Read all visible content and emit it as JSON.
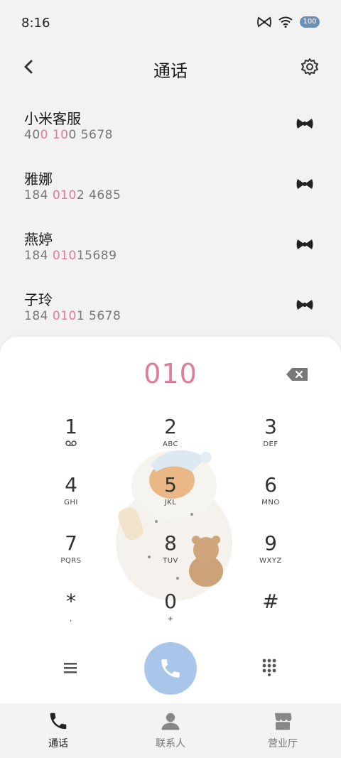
{
  "status_bar": {
    "time": "8:16",
    "battery": "100"
  },
  "header": {
    "title": "通话"
  },
  "calls": [
    {
      "name": "小米客服",
      "number_parts": [
        "40",
        "0 10",
        "0 5678"
      ]
    },
    {
      "name": "雅娜",
      "number_parts": [
        "184 ",
        "010",
        "2 4685"
      ]
    },
    {
      "name": "燕婷",
      "number_parts": [
        "184 ",
        "010",
        "15689"
      ]
    },
    {
      "name": "子玲",
      "number_parts": [
        "184 ",
        "010",
        "1 5678"
      ]
    }
  ],
  "dialer": {
    "input_value": "010"
  },
  "keypad": [
    {
      "digit": "1",
      "letters": ""
    },
    {
      "digit": "2",
      "letters": "ABC"
    },
    {
      "digit": "3",
      "letters": "DEF"
    },
    {
      "digit": "4",
      "letters": "GHI"
    },
    {
      "digit": "5",
      "letters": "JKL"
    },
    {
      "digit": "6",
      "letters": "MNO"
    },
    {
      "digit": "7",
      "letters": "PQRS"
    },
    {
      "digit": "8",
      "letters": "TUV"
    },
    {
      "digit": "9",
      "letters": "WXYZ"
    },
    {
      "digit": "*",
      "letters": ","
    },
    {
      "digit": "0",
      "letters": "+"
    },
    {
      "digit": "#",
      "letters": ""
    }
  ],
  "nav": {
    "calls": "通话",
    "contacts": "联系人",
    "store": "营业厅"
  },
  "colors": {
    "accent_pink": "#e07b9a",
    "call_button": "#a9c6ea"
  },
  "icons": {
    "key1_sub": "voicemail-icon",
    "row_action": "bow-icon",
    "back": "chevron-left-icon",
    "settings": "gear-icon"
  }
}
